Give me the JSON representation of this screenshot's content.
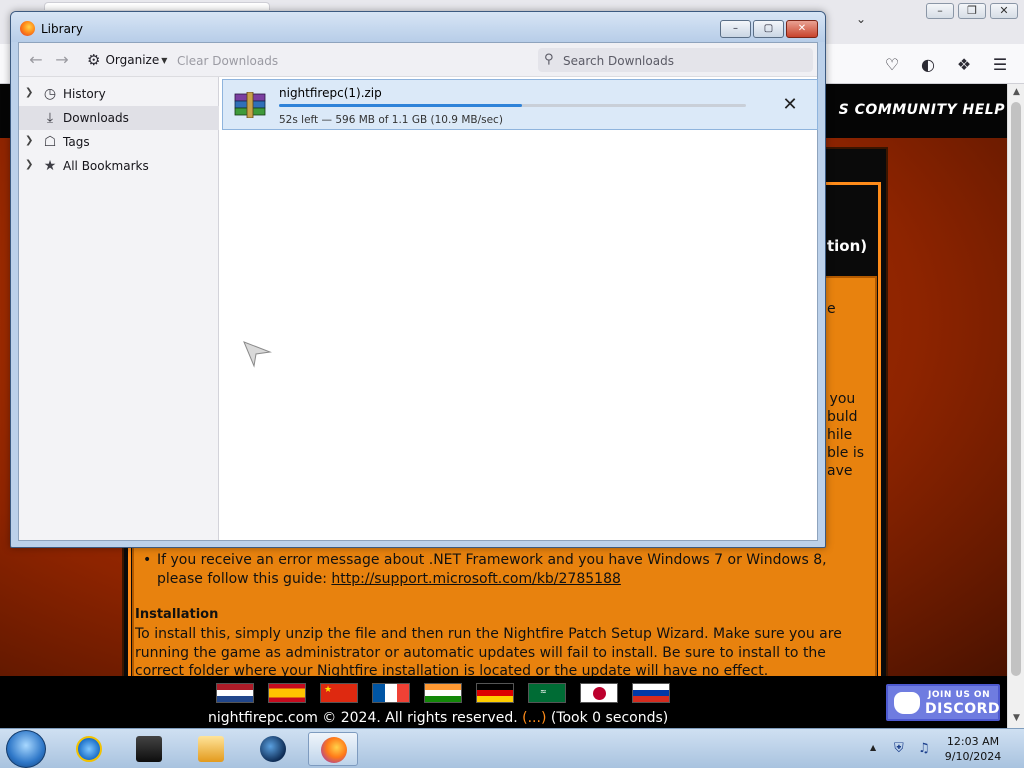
{
  "library": {
    "title": "Library",
    "toolbar": {
      "organize_label": "Organize",
      "clear_downloads_label": "Clear Downloads",
      "search_placeholder": "Search Downloads"
    },
    "sidebar": {
      "items": [
        {
          "label": "History",
          "icon": "clock-icon"
        },
        {
          "label": "Downloads",
          "icon": "download-icon"
        },
        {
          "label": "Tags",
          "icon": "tag-icon"
        },
        {
          "label": "All Bookmarks",
          "icon": "star-icon"
        }
      ],
      "selected": "Downloads"
    },
    "download": {
      "filename": "nightfirepc(1).zip",
      "status": "52s left — 596 MB of 1.1 GB (10.9 MB/sec)",
      "progress_fraction": 0.52
    }
  },
  "site": {
    "community_help": "S COMMUNITY HELP",
    "heading_fragment": "tion)",
    "side_fragments": [
      "e",
      "k you",
      "buld",
      "hile",
      "ble is",
      "ave"
    ],
    "bullet_text": "If you receive an error message about .NET Framework and you have Windows 7 or Windows 8, please follow this guide: ",
    "bullet_link": "http://support.microsoft.com/kb/2785188",
    "installation_title": "Installation",
    "installation_body": "To install this, simply unzip the file and then run the Nightfire Patch Setup Wizard. Make sure you are running the game as administrator or automatic updates will fail to install. Be sure to install to the correct folder where your Nightfire installation is located or the update will have no effect.",
    "footer_copyright": "nightfirepc.com © 2024. All rights reserved. ",
    "footer_dots": "(...)",
    "footer_took": " (Took 0 seconds)",
    "discord_line1": "JOIN US ON",
    "discord_line2": "DISCORD",
    "flags": [
      "netherlands",
      "spain",
      "china",
      "france",
      "india",
      "germany",
      "saudi-arabia",
      "japan",
      "russia"
    ]
  },
  "taskbar": {
    "apps": [
      "internet-explorer",
      "media-center",
      "media-player",
      "network-globe",
      "firefox"
    ],
    "active_app": "firefox",
    "time": "12:03 AM",
    "date": "9/10/2024"
  },
  "colors": {
    "site_orange": "#e8820e",
    "progress_blue": "#2f83d9",
    "selection_row": "#dbe9f8"
  }
}
